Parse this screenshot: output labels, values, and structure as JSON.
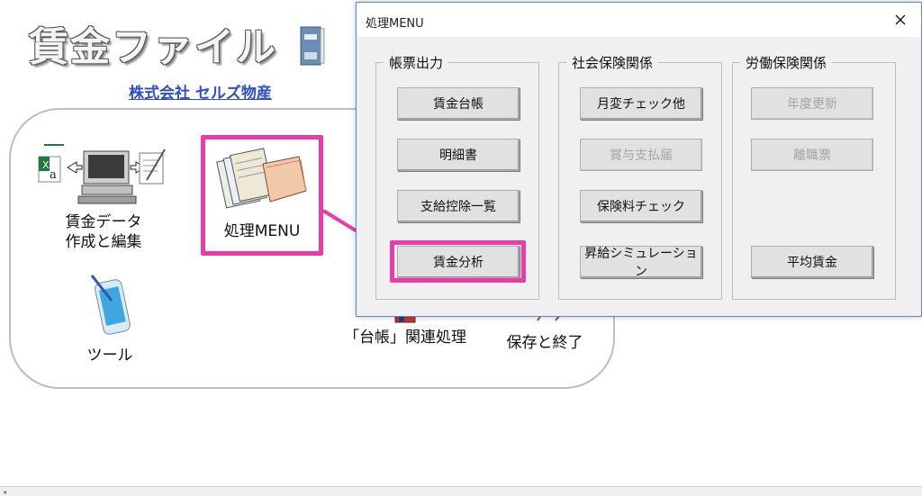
{
  "app": {
    "title": "賃金ファイル",
    "company": "株式会社 セルズ物産"
  },
  "menu": {
    "items": [
      {
        "line1": "賃金データ",
        "line2": "作成と編集"
      },
      {
        "line1": "処理MENU",
        "line2": ""
      },
      {
        "line1": "ツール",
        "line2": ""
      },
      {
        "line1": "「台帳」関連処理",
        "line2": ""
      },
      {
        "line1": "保存と終了",
        "line2": ""
      }
    ]
  },
  "dialog": {
    "title": "処理MENU",
    "groups": [
      {
        "label": "帳票出力",
        "buttons": [
          "賃金台帳",
          "明細書",
          "支給控除一覧",
          "賃金分析"
        ]
      },
      {
        "label": "社会保険関係",
        "buttons": [
          "月変チェック他",
          "賞与支払届",
          "保険料チェック",
          "昇給シミュレーション"
        ]
      },
      {
        "label": "労働保険関係",
        "buttons": [
          "年度更新",
          "離職票",
          "平均賃金"
        ]
      }
    ]
  },
  "colors": {
    "highlight": "#ec3aa6",
    "link": "#2a4fc6",
    "dialog_border": "#5b8cc9"
  }
}
